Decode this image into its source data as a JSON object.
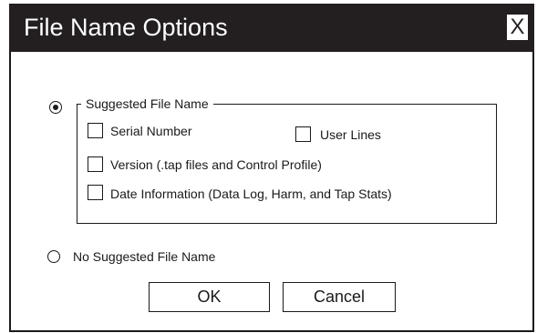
{
  "window": {
    "title": "File Name Options",
    "close_label": "X"
  },
  "options": {
    "suggested": {
      "label": "Suggested File Name",
      "selected": true
    },
    "none": {
      "label": "No Suggested File Name",
      "selected": false
    }
  },
  "checkboxes": {
    "serial_number": {
      "label": "Serial Number",
      "checked": false
    },
    "user_lines": {
      "label": "User Lines",
      "checked": false
    },
    "version": {
      "label": "Version (.tap files and Control Profile)",
      "checked": false
    },
    "date_info": {
      "label": "Date Information (Data Log, Harm, and Tap Stats)",
      "checked": false
    }
  },
  "buttons": {
    "ok": "OK",
    "cancel": "Cancel"
  },
  "colors": {
    "titlebar": "#231f20",
    "title_text": "#ffffff",
    "border": "#1a1a1a"
  }
}
